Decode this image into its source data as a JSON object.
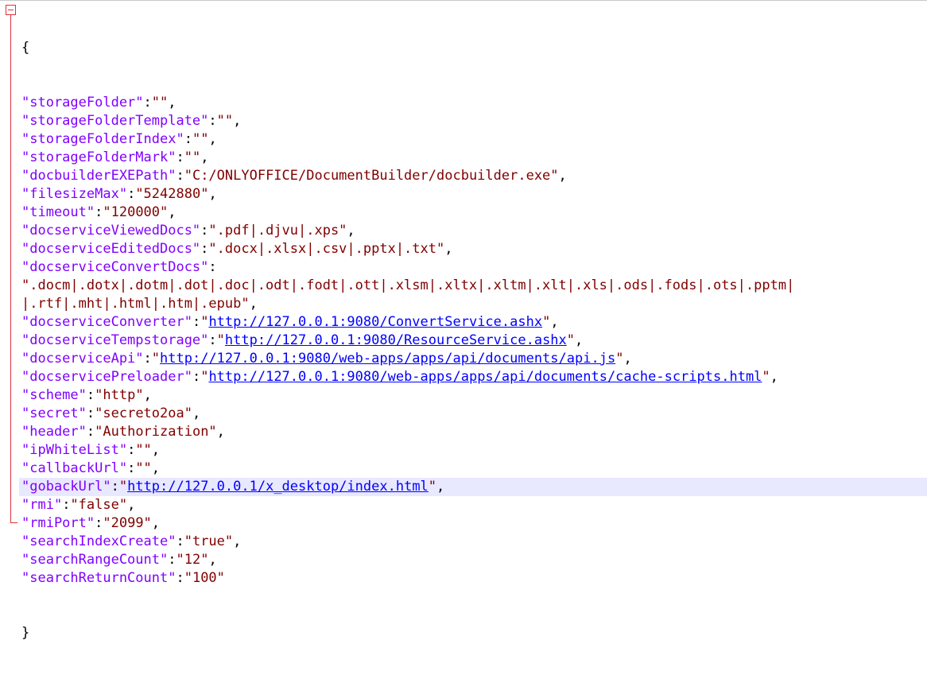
{
  "editor": {
    "open_brace": "{",
    "close_brace": "}",
    "comma": ",",
    "lines": [
      {
        "key": "\"storageFolder\"",
        "sep": ":",
        "value": "\"\"",
        "comma": ","
      },
      {
        "key": "\"storageFolderTemplate\"",
        "sep": ":",
        "value": "\"\"",
        "comma": ","
      },
      {
        "key": "\"storageFolderIndex\"",
        "sep": ":",
        "value": "\"\"",
        "comma": ","
      },
      {
        "key": "\"storageFolderMark\"",
        "sep": ":",
        "value": "\"\"",
        "comma": ","
      },
      {
        "key": "\"docbuilderEXEPath\"",
        "sep": ":",
        "value": "\"C:/ONLYOFFICE/DocumentBuilder/docbuilder.exe\"",
        "comma": ","
      },
      {
        "key": "\"filesizeMax\"",
        "sep": ":",
        "value": "\"5242880\"",
        "comma": ","
      },
      {
        "key": "\"timeout\"",
        "sep": ":",
        "value": "\"120000\"",
        "comma": ","
      },
      {
        "key": "\"docserviceViewedDocs\"",
        "sep": ":",
        "value": "\".pdf|.djvu|.xps\"",
        "comma": ","
      },
      {
        "key": "\"docserviceEditedDocs\"",
        "sep": ":",
        "value": "\".docx|.xlsx|.csv|.pptx|.txt\"",
        "comma": ","
      },
      {
        "key": "\"docserviceConvertDocs\"",
        "sep": ":",
        "value": "",
        "comma": ""
      },
      {
        "key": "",
        "sep": "",
        "value": "\".docm|.dotx|.dotm|.dot|.doc|.odt|.fodt|.ott|.xlsm|.xltx|.xltm|.xlt|.xls|.ods|.fods|.ots|.pptm|",
        "comma": ""
      },
      {
        "key": "",
        "sep": "",
        "value": "|.rtf|.mht|.html|.htm|.epub\"",
        "comma": ","
      },
      {
        "key": "\"docserviceConverter\"",
        "sep": ":",
        "q1": "\"",
        "url": "http://127.0.0.1:9080/ConvertService.ashx",
        "q2": "\"",
        "comma": ","
      },
      {
        "key": "\"docserviceTempstorage\"",
        "sep": ":",
        "q1": "\"",
        "url": "http://127.0.0.1:9080/ResourceService.ashx",
        "q2": "\"",
        "comma": ","
      },
      {
        "key": "\"docserviceApi\"",
        "sep": ":",
        "q1": "\"",
        "url": "http://127.0.0.1:9080/web-apps/apps/api/documents/api.js",
        "q2": "\"",
        "comma": ","
      },
      {
        "key": "\"docservicePreloader\"",
        "sep": ":",
        "q1": "\"",
        "url": "http://127.0.0.1:9080/web-apps/apps/api/documents/cache-scripts.html",
        "q2": "\"",
        "comma": ","
      },
      {
        "key": "\"scheme\"",
        "sep": ":",
        "value": "\"http\"",
        "comma": ","
      },
      {
        "key": "\"secret\"",
        "sep": ":",
        "value": "\"secreto2oa\"",
        "comma": ","
      },
      {
        "key": "\"header\"",
        "sep": ":",
        "value": "\"Authorization\"",
        "comma": ","
      },
      {
        "key": "\"ipWhiteList\"",
        "sep": ":",
        "value": "\"\"",
        "comma": ","
      },
      {
        "key": "\"callbackUrl\"",
        "sep": ":",
        "value": "\"\"",
        "comma": ","
      },
      {
        "key": "\"gobackUrl\"",
        "sep": ":",
        "q1": "\"",
        "url": "http://127.0.0.1/x_desktop/index.html",
        "q2": "\"",
        "comma": ",",
        "current": true
      },
      {
        "key": "\"rmi\"",
        "sep": ":",
        "value": "\"false\"",
        "comma": ","
      },
      {
        "key": "\"rmiPort\"",
        "sep": ":",
        "value": "\"2099\"",
        "comma": ","
      },
      {
        "key": "\"searchIndexCreate\"",
        "sep": ":",
        "value": "\"true\"",
        "comma": ","
      },
      {
        "key": "\"searchRangeCount\"",
        "sep": ":",
        "value": "\"12\"",
        "comma": ","
      },
      {
        "key": "\"searchReturnCount\"",
        "sep": ":",
        "value": "\"100\"",
        "comma": ""
      }
    ]
  },
  "colors": {
    "key": "#8000ff",
    "string": "#800000",
    "url": "#0000ff",
    "fold_marker": "#e0303a",
    "current_line": "#e8e8ff"
  }
}
